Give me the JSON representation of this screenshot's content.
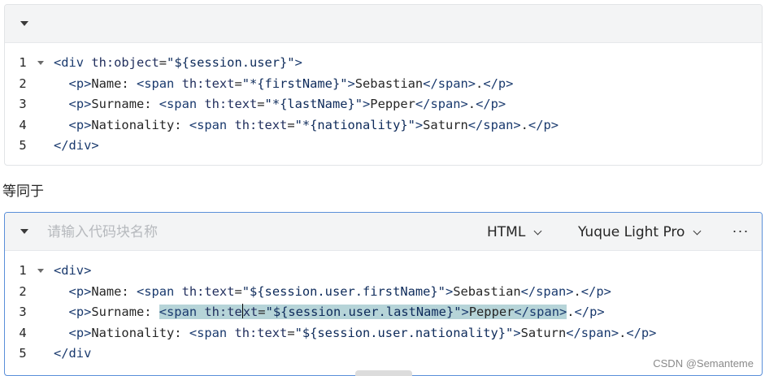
{
  "block1": {
    "lines": [
      {
        "n": "1",
        "fold": true,
        "html": "<span class='tag'>&lt;div</span> <span class='attr'>th:object</span>=<span class='str'>\"${session.user}\"</span><span class='tag'>&gt;</span>"
      },
      {
        "n": "2",
        "fold": false,
        "html": "  <span class='tag'>&lt;p&gt;</span>Name: <span class='tag'>&lt;span</span> <span class='attr'>th:text</span>=<span class='str'>\"*{firstName}\"</span><span class='tag'>&gt;</span>Sebastian<span class='tag'>&lt;/span&gt;</span>.<span class='tag'>&lt;/p&gt;</span>"
      },
      {
        "n": "3",
        "fold": false,
        "html": "  <span class='tag'>&lt;p&gt;</span>Surname: <span class='tag'>&lt;span</span> <span class='attr'>th:text</span>=<span class='str'>\"*{lastName}\"</span><span class='tag'>&gt;</span>Pepper<span class='tag'>&lt;/span&gt;</span>.<span class='tag'>&lt;/p&gt;</span>"
      },
      {
        "n": "4",
        "fold": false,
        "html": "  <span class='tag'>&lt;p&gt;</span>Nationality: <span class='tag'>&lt;span</span> <span class='attr'>th:text</span>=<span class='str'>\"*{nationality}\"</span><span class='tag'>&gt;</span>Saturn<span class='tag'>&lt;/span&gt;</span>.<span class='tag'>&lt;/p&gt;</span>"
      },
      {
        "n": "5",
        "fold": false,
        "html": "<span class='tag'>&lt;/div&gt;</span>"
      }
    ]
  },
  "between_text": "等同于",
  "block2": {
    "name_placeholder": "请输入代码块名称",
    "language": "HTML",
    "theme": "Yuque Light Pro",
    "more": "···",
    "lines": [
      {
        "n": "1",
        "fold": true,
        "html": "<span class='tag'>&lt;div&gt;</span>"
      },
      {
        "n": "2",
        "fold": false,
        "html": "  <span class='tag'>&lt;p&gt;</span>Name: <span class='tag'>&lt;span</span> <span class='attr'>th:text</span>=<span class='str'>\"${session.user.firstName}\"</span><span class='tag'>&gt;</span>Sebastian<span class='tag'>&lt;/span&gt;</span>.<span class='tag'>&lt;/p&gt;</span>"
      },
      {
        "n": "3",
        "fold": false,
        "html": "  <span class='tag'>&lt;p&gt;</span>Surname: <span class='sel'><span class='tag'>&lt;span</span> <span class='attr'>th:te</span><span class='cursor'></span><span class='attr'>xt</span>=<span class='str'>\"${session.user.lastName}\"</span><span class='tag'>&gt;</span>Pepper<span class='tag'>&lt;/span&gt;</span></span>.<span class='tag'>&lt;/p&gt;</span>"
      },
      {
        "n": "4",
        "fold": false,
        "html": "  <span class='tag'>&lt;p&gt;</span>Nationality: <span class='tag'>&lt;span</span> <span class='attr'>th:text</span>=<span class='str'>\"${session.user.nationality}\"</span><span class='tag'>&gt;</span>Saturn<span class='tag'>&lt;/span&gt;</span>.<span class='tag'>&lt;/p&gt;</span>"
      },
      {
        "n": "5",
        "fold": false,
        "html": "<span class='tag'>&lt;/div</span>"
      }
    ]
  },
  "watermark": "CSDN @Semanteme"
}
